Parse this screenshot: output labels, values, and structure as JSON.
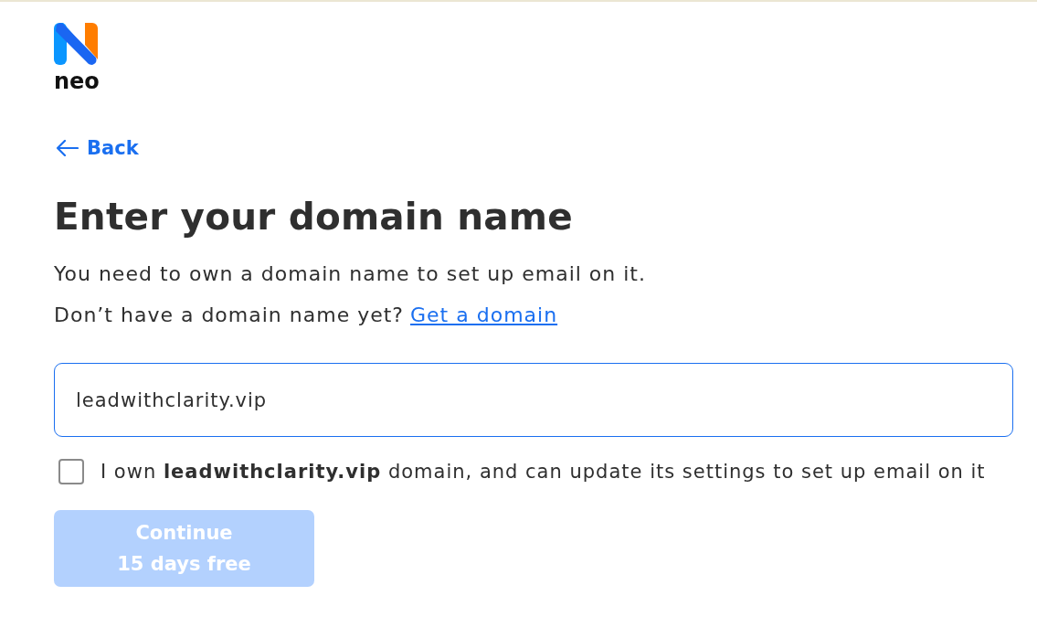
{
  "logo": {
    "text": "neo"
  },
  "back_link": {
    "label": "Back"
  },
  "heading": "Enter your domain name",
  "intro": [
    "You need to own a domain name to set up email on it.",
    "Don’t have a domain name yet?"
  ],
  "get_domain_link": "Get a domain",
  "domain_field": {
    "value": "leadwithclarity.vip"
  },
  "ownership_checkbox": {
    "label": "I own **leadwithclarity.vip** domain, and can update its settings to set up email on it",
    "checked": false
  },
  "continue_button": {
    "label": "Continue",
    "sublabel": "15 days free",
    "disabled": true
  }
}
